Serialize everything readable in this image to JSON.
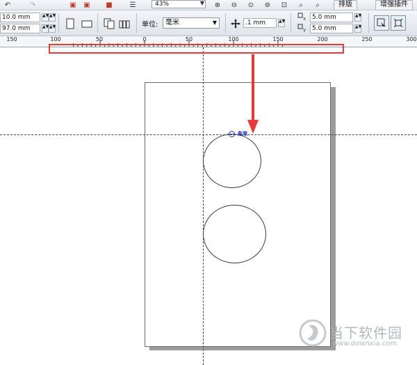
{
  "toolbar": {
    "zoom_value": "43%",
    "arrange_label": "排版",
    "enhance_label": "增强插件"
  },
  "propbar": {
    "width_value": "10.0 mm",
    "height_value": "97.0 mm",
    "units_label": "单位:",
    "units_value": "毫米",
    "nudge_value": ".1 mm",
    "dup_x_value": "5.0 mm",
    "dup_y_value": "5.0 mm"
  },
  "ruler": {
    "ticks": [
      "150",
      "100",
      "50",
      "0",
      "50",
      "100",
      "150",
      "200",
      "250",
      "300"
    ]
  },
  "canvas": {
    "snap_label": "象限"
  },
  "watermark": {
    "name": "当下软件园",
    "url": "www.downxia.com"
  },
  "colors": {
    "highlight": "#e53a3a",
    "snap": "#1d2fb8"
  }
}
